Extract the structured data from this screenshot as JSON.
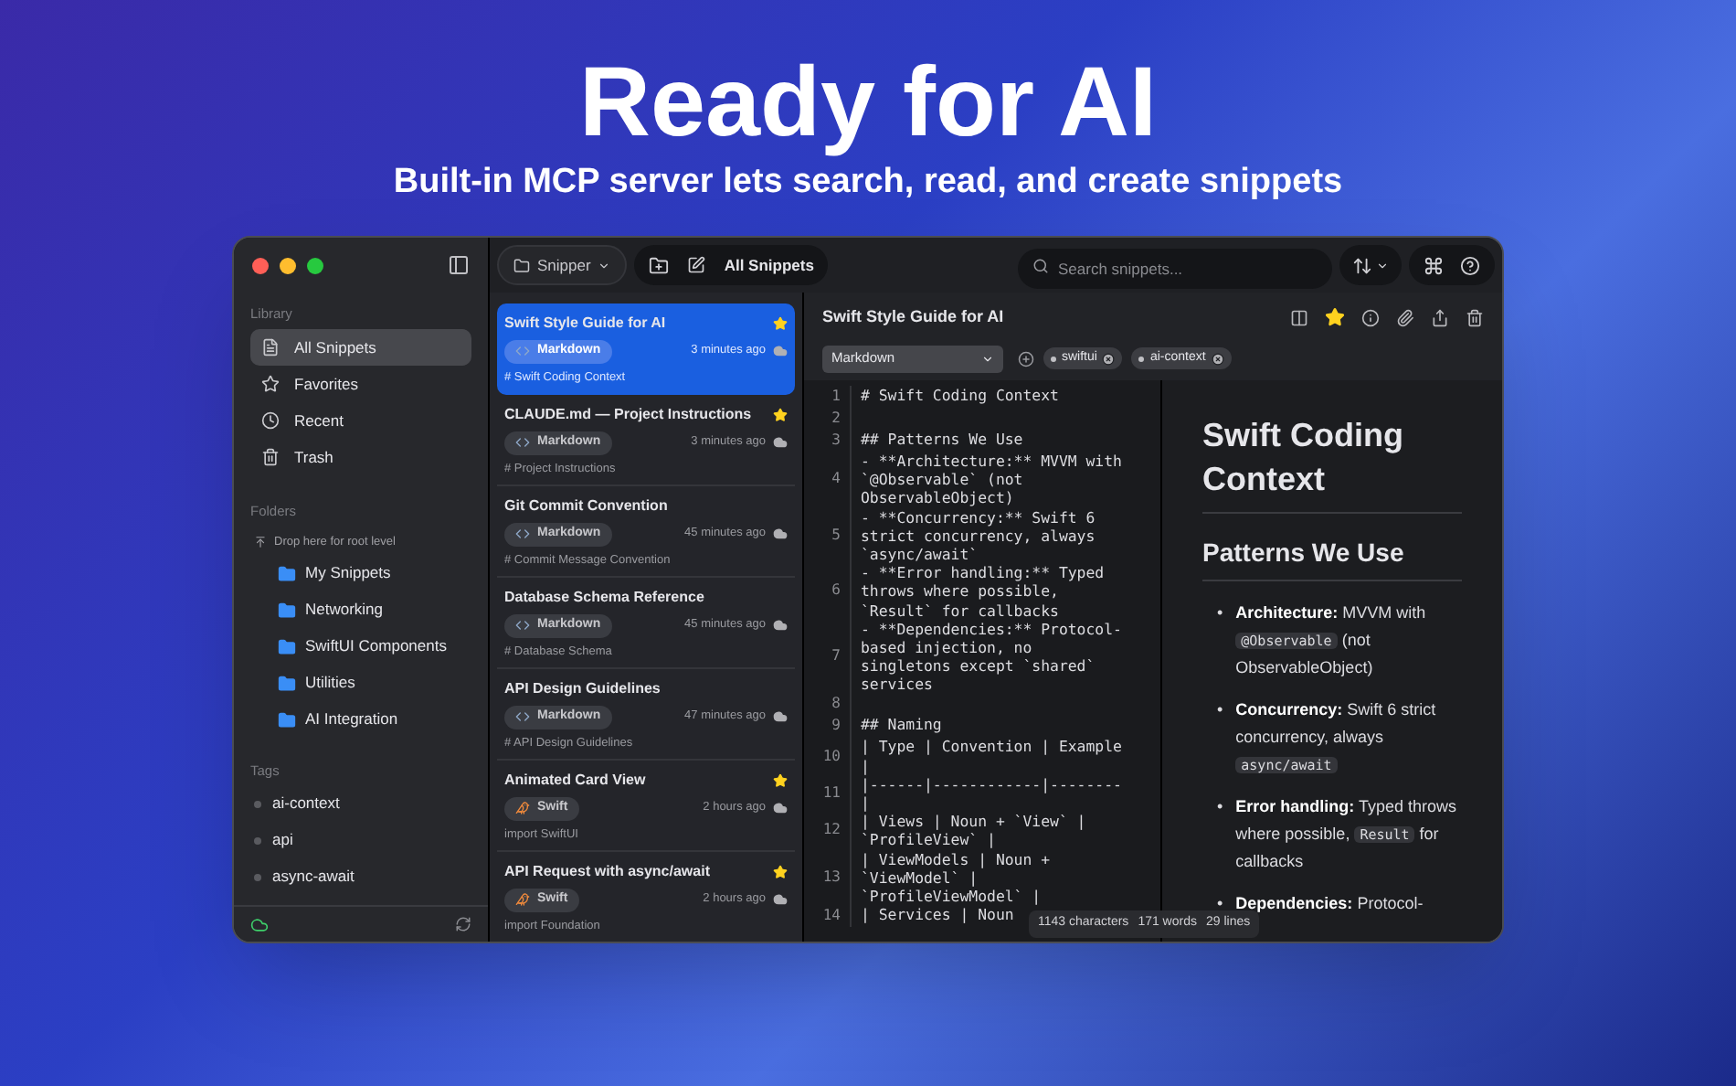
{
  "hero": {
    "title": "Ready for AI",
    "subtitle": "Built-in MCP server lets search, read, and create snippets"
  },
  "sidebar": {
    "library_heading": "Library",
    "library": [
      {
        "label": "All Snippets",
        "kind": "all",
        "selected": true
      },
      {
        "label": "Favorites",
        "kind": "favorites",
        "selected": false
      },
      {
        "label": "Recent",
        "kind": "recent",
        "selected": false
      },
      {
        "label": "Trash",
        "kind": "trash",
        "selected": false
      }
    ],
    "folders_heading": "Folders",
    "drop_hint": "Drop here for root level",
    "folders": [
      {
        "name": "My Snippets"
      },
      {
        "name": "Networking"
      },
      {
        "name": "SwiftUI Components"
      },
      {
        "name": "Utilities"
      },
      {
        "name": "AI Integration"
      }
    ],
    "tags_heading": "Tags",
    "tags": [
      {
        "name": "ai-context"
      },
      {
        "name": "api"
      },
      {
        "name": "async-await"
      }
    ]
  },
  "toolbar": {
    "folder_menu": "Snipper",
    "current_view": "All Snippets",
    "search": {
      "placeholder": "Search snippets..."
    }
  },
  "snippets": [
    {
      "title": "Swift Style Guide for AI",
      "language": "Markdown",
      "kind": "markdown",
      "time": "3 minutes ago",
      "preview": "# Swift Coding Context",
      "favorite": true,
      "selected": true
    },
    {
      "title": "CLAUDE.md — Project Instructions",
      "language": "Markdown",
      "kind": "markdown",
      "time": "3 minutes ago",
      "preview": "# Project Instructions",
      "favorite": true,
      "selected": false
    },
    {
      "title": "Git Commit Convention",
      "language": "Markdown",
      "kind": "markdown",
      "time": "45 minutes ago",
      "preview": "# Commit Message Convention",
      "favorite": false,
      "selected": false
    },
    {
      "title": "Database Schema Reference",
      "language": "Markdown",
      "kind": "markdown",
      "time": "45 minutes ago",
      "preview": "# Database Schema",
      "favorite": false,
      "selected": false
    },
    {
      "title": "API Design Guidelines",
      "language": "Markdown",
      "kind": "markdown",
      "time": "47 minutes ago",
      "preview": "# API Design Guidelines",
      "favorite": false,
      "selected": false
    },
    {
      "title": "Animated Card View",
      "language": "Swift",
      "kind": "swift",
      "time": "2 hours ago",
      "preview": "import SwiftUI",
      "favorite": true,
      "selected": false
    },
    {
      "title": "API Request with async/await",
      "language": "Swift",
      "kind": "swift",
      "time": "2 hours ago",
      "preview": "import Foundation",
      "favorite": true,
      "selected": false
    }
  ],
  "detail": {
    "title": "Swift Style Guide for AI",
    "favorite": true,
    "language": "Markdown",
    "tags": [
      "swiftui",
      "ai-context"
    ],
    "code_lines": [
      {
        "number": "1",
        "rows": [
          "# Swift Coding Context"
        ]
      },
      {
        "number": "2",
        "rows": [
          ""
        ]
      },
      {
        "number": "3",
        "rows": [
          "## Patterns We Use"
        ]
      },
      {
        "number": "4",
        "rows": [
          "- **Architecture:** MVVM with",
          "`@Observable` (not",
          "ObservableObject)"
        ]
      },
      {
        "number": "5",
        "rows": [
          "- **Concurrency:** Swift 6",
          "strict concurrency, always",
          "`async/await`"
        ]
      },
      {
        "number": "6",
        "rows": [
          "- **Error handling:** Typed",
          "throws where possible,",
          "`Result` for callbacks"
        ]
      },
      {
        "number": "7",
        "rows": [
          "- **Dependencies:** Protocol-",
          "based injection, no",
          "singletons except `shared`",
          "services"
        ]
      },
      {
        "number": "8",
        "rows": [
          ""
        ]
      },
      {
        "number": "9",
        "rows": [
          "## Naming"
        ]
      },
      {
        "number": "10",
        "rows": [
          "| Type | Convention | Example",
          "|"
        ]
      },
      {
        "number": "11",
        "rows": [
          "|------|------------|--------",
          "|"
        ]
      },
      {
        "number": "12",
        "rows": [
          "| Views | Noun + `View` |",
          "`ProfileView` |"
        ]
      },
      {
        "number": "13",
        "rows": [
          "| ViewModels | Noun +",
          "`ViewModel` |",
          "`ProfileViewModel` |"
        ]
      },
      {
        "number": "14",
        "rows": [
          "| Services | Noun"
        ]
      }
    ],
    "status": {
      "characters": "1143 characters",
      "words": "171 words",
      "lines": "29 lines"
    },
    "preview": {
      "h1": "Swift Coding Context",
      "h2": "Patterns We Use",
      "bullets": [
        {
          "marker": "•",
          "parts": [
            {
              "kind": "bold",
              "text": "Architecture:"
            },
            {
              "kind": "text",
              "text": " MVVM with "
            },
            {
              "kind": "code",
              "text": "@Observable"
            },
            {
              "kind": "text",
              "text": " (not ObservableObject)"
            }
          ]
        },
        {
          "marker": "•",
          "parts": [
            {
              "kind": "bold",
              "text": "Concurrency:"
            },
            {
              "kind": "text",
              "text": " Swift 6 strict concurrency, always "
            },
            {
              "kind": "code",
              "text": "async/await"
            }
          ]
        },
        {
          "marker": "•",
          "parts": [
            {
              "kind": "bold",
              "text": "Error handling:"
            },
            {
              "kind": "text",
              "text": " Typed throws where possible, "
            },
            {
              "kind": "code",
              "text": "Result"
            },
            {
              "kind": "text",
              "text": " for callbacks"
            }
          ]
        },
        {
          "marker": "•",
          "parts": [
            {
              "kind": "bold",
              "text": "Dependencies:"
            },
            {
              "kind": "text",
              "text": " Protocol-"
            }
          ]
        }
      ]
    }
  }
}
